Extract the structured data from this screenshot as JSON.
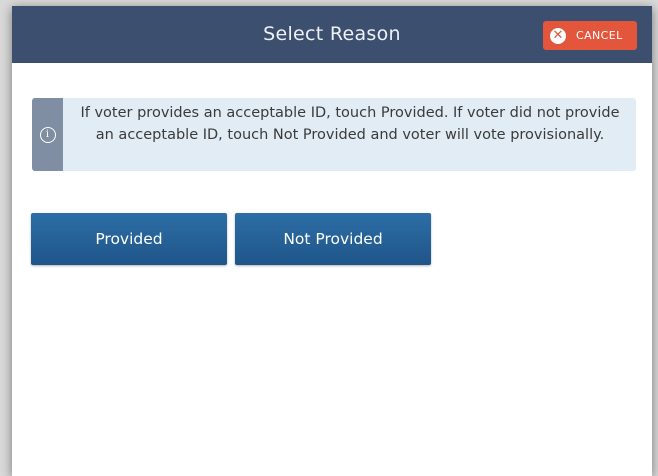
{
  "header": {
    "title": "Select Reason",
    "cancel_label": "CANCEL",
    "cancel_icon": "close-icon"
  },
  "info": {
    "icon": "info-icon",
    "message": "If voter provides an acceptable ID, touch Provided. If voter did not provide an acceptable ID, touch Not Provided and voter will vote provisionally."
  },
  "buttons": {
    "provided_label": "Provided",
    "not_provided_label": "Not Provided"
  },
  "colors": {
    "header_bg": "#3d4f6f",
    "cancel_bg": "#e4563b",
    "info_bg": "#e1ecf5",
    "button_bg": "#1f5589"
  }
}
